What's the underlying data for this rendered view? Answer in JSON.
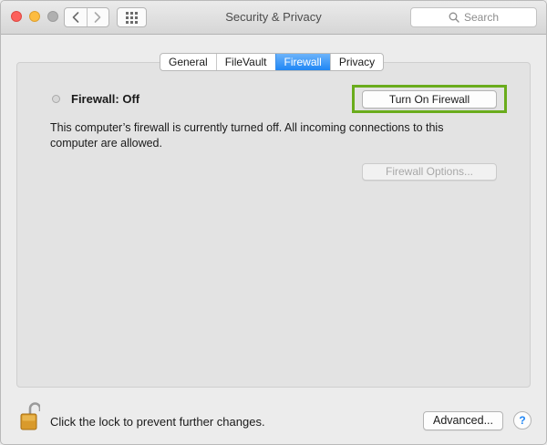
{
  "window": {
    "title": "Security & Privacy",
    "search_placeholder": "Search"
  },
  "toolbar": {
    "back_icon": "chevron-left-icon",
    "forward_icon": "chevron-right-icon",
    "show_all_icon": "grid-icon"
  },
  "tabs": [
    {
      "label": "General",
      "active": false
    },
    {
      "label": "FileVault",
      "active": false
    },
    {
      "label": "Firewall",
      "active": true
    },
    {
      "label": "Privacy",
      "active": false
    }
  ],
  "firewall": {
    "status_label": "Firewall: Off",
    "turn_on_button": "Turn On Firewall",
    "description": "This computer’s firewall is currently turned off. All incoming connections to this computer are allowed.",
    "options_button": "Firewall Options..."
  },
  "footer": {
    "lock_text": "Click the lock to prevent further changes.",
    "advanced_button": "Advanced...",
    "help_button": "?"
  },
  "colors": {
    "accent": "#1f86f5",
    "highlight": "#6aac1c",
    "close": "#fc605b",
    "minimize": "#fdbc40"
  }
}
